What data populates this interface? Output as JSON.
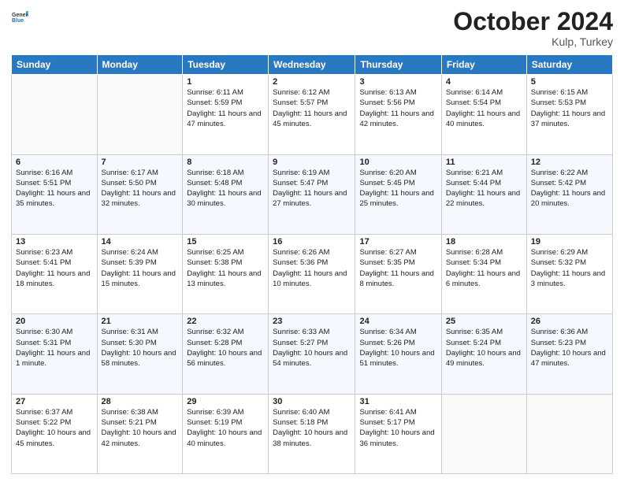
{
  "header": {
    "logo_general": "General",
    "logo_blue": "Blue",
    "title": "October 2024",
    "location": "Kulp, Turkey"
  },
  "days_of_week": [
    "Sunday",
    "Monday",
    "Tuesday",
    "Wednesday",
    "Thursday",
    "Friday",
    "Saturday"
  ],
  "weeks": [
    [
      {
        "day": "",
        "info": ""
      },
      {
        "day": "",
        "info": ""
      },
      {
        "day": "1",
        "info": "Sunrise: 6:11 AM\nSunset: 5:59 PM\nDaylight: 11 hours and 47 minutes."
      },
      {
        "day": "2",
        "info": "Sunrise: 6:12 AM\nSunset: 5:57 PM\nDaylight: 11 hours and 45 minutes."
      },
      {
        "day": "3",
        "info": "Sunrise: 6:13 AM\nSunset: 5:56 PM\nDaylight: 11 hours and 42 minutes."
      },
      {
        "day": "4",
        "info": "Sunrise: 6:14 AM\nSunset: 5:54 PM\nDaylight: 11 hours and 40 minutes."
      },
      {
        "day": "5",
        "info": "Sunrise: 6:15 AM\nSunset: 5:53 PM\nDaylight: 11 hours and 37 minutes."
      }
    ],
    [
      {
        "day": "6",
        "info": "Sunrise: 6:16 AM\nSunset: 5:51 PM\nDaylight: 11 hours and 35 minutes."
      },
      {
        "day": "7",
        "info": "Sunrise: 6:17 AM\nSunset: 5:50 PM\nDaylight: 11 hours and 32 minutes."
      },
      {
        "day": "8",
        "info": "Sunrise: 6:18 AM\nSunset: 5:48 PM\nDaylight: 11 hours and 30 minutes."
      },
      {
        "day": "9",
        "info": "Sunrise: 6:19 AM\nSunset: 5:47 PM\nDaylight: 11 hours and 27 minutes."
      },
      {
        "day": "10",
        "info": "Sunrise: 6:20 AM\nSunset: 5:45 PM\nDaylight: 11 hours and 25 minutes."
      },
      {
        "day": "11",
        "info": "Sunrise: 6:21 AM\nSunset: 5:44 PM\nDaylight: 11 hours and 22 minutes."
      },
      {
        "day": "12",
        "info": "Sunrise: 6:22 AM\nSunset: 5:42 PM\nDaylight: 11 hours and 20 minutes."
      }
    ],
    [
      {
        "day": "13",
        "info": "Sunrise: 6:23 AM\nSunset: 5:41 PM\nDaylight: 11 hours and 18 minutes."
      },
      {
        "day": "14",
        "info": "Sunrise: 6:24 AM\nSunset: 5:39 PM\nDaylight: 11 hours and 15 minutes."
      },
      {
        "day": "15",
        "info": "Sunrise: 6:25 AM\nSunset: 5:38 PM\nDaylight: 11 hours and 13 minutes."
      },
      {
        "day": "16",
        "info": "Sunrise: 6:26 AM\nSunset: 5:36 PM\nDaylight: 11 hours and 10 minutes."
      },
      {
        "day": "17",
        "info": "Sunrise: 6:27 AM\nSunset: 5:35 PM\nDaylight: 11 hours and 8 minutes."
      },
      {
        "day": "18",
        "info": "Sunrise: 6:28 AM\nSunset: 5:34 PM\nDaylight: 11 hours and 6 minutes."
      },
      {
        "day": "19",
        "info": "Sunrise: 6:29 AM\nSunset: 5:32 PM\nDaylight: 11 hours and 3 minutes."
      }
    ],
    [
      {
        "day": "20",
        "info": "Sunrise: 6:30 AM\nSunset: 5:31 PM\nDaylight: 11 hours and 1 minute."
      },
      {
        "day": "21",
        "info": "Sunrise: 6:31 AM\nSunset: 5:30 PM\nDaylight: 10 hours and 58 minutes."
      },
      {
        "day": "22",
        "info": "Sunrise: 6:32 AM\nSunset: 5:28 PM\nDaylight: 10 hours and 56 minutes."
      },
      {
        "day": "23",
        "info": "Sunrise: 6:33 AM\nSunset: 5:27 PM\nDaylight: 10 hours and 54 minutes."
      },
      {
        "day": "24",
        "info": "Sunrise: 6:34 AM\nSunset: 5:26 PM\nDaylight: 10 hours and 51 minutes."
      },
      {
        "day": "25",
        "info": "Sunrise: 6:35 AM\nSunset: 5:24 PM\nDaylight: 10 hours and 49 minutes."
      },
      {
        "day": "26",
        "info": "Sunrise: 6:36 AM\nSunset: 5:23 PM\nDaylight: 10 hours and 47 minutes."
      }
    ],
    [
      {
        "day": "27",
        "info": "Sunrise: 6:37 AM\nSunset: 5:22 PM\nDaylight: 10 hours and 45 minutes."
      },
      {
        "day": "28",
        "info": "Sunrise: 6:38 AM\nSunset: 5:21 PM\nDaylight: 10 hours and 42 minutes."
      },
      {
        "day": "29",
        "info": "Sunrise: 6:39 AM\nSunset: 5:19 PM\nDaylight: 10 hours and 40 minutes."
      },
      {
        "day": "30",
        "info": "Sunrise: 6:40 AM\nSunset: 5:18 PM\nDaylight: 10 hours and 38 minutes."
      },
      {
        "day": "31",
        "info": "Sunrise: 6:41 AM\nSunset: 5:17 PM\nDaylight: 10 hours and 36 minutes."
      },
      {
        "day": "",
        "info": ""
      },
      {
        "day": "",
        "info": ""
      }
    ]
  ]
}
